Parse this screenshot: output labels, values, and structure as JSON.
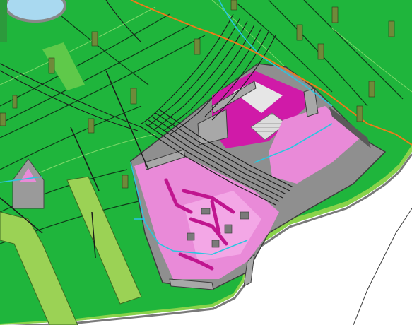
{
  "viewport": {
    "view_type": "3d-isometric-bim-model",
    "colors": {
      "background": "#f4f6f4",
      "terrain": "#1fb53c",
      "terrain_light": "#8ad24a",
      "wall_grey": "#9a9a9a",
      "wall_dark": "#5a5a5a",
      "floor_pink": "#e98ad8",
      "floor_magenta": "#d01aa8",
      "pipe_dark": "#1a1a1a",
      "pipe_cyan": "#29c7e0",
      "pipe_orange": "#f07a1a"
    }
  }
}
